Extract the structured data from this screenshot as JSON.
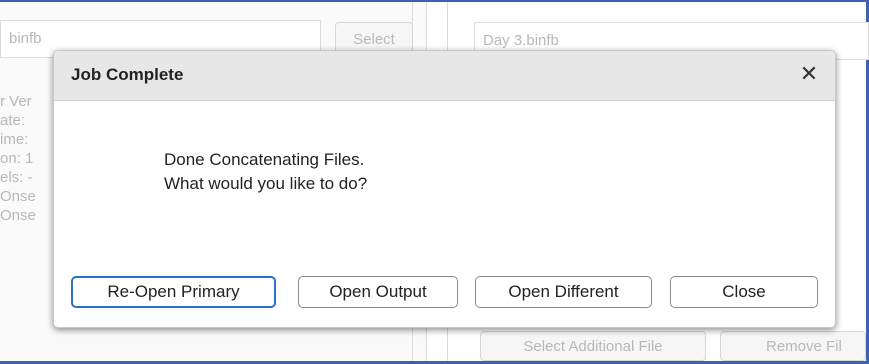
{
  "background": {
    "primary_file": {
      "value": "binfb"
    },
    "select_button": {
      "label": "Select"
    },
    "secondary_file": {
      "value": "Day 3.binfb"
    },
    "info_lines": [
      "r Ver",
      "ate:",
      "ime:",
      "on: 1",
      "els: -",
      "Onse",
      "Onse"
    ],
    "select_additional_button": {
      "label": "Select Additional File"
    },
    "remove_file_button": {
      "label": "Remove Fil"
    }
  },
  "dialog": {
    "title": "Job Complete",
    "close_glyph": "✕",
    "message_lines": [
      "Done Concatenating Files.",
      "What would you like to do?"
    ],
    "buttons": [
      {
        "label": "Re-Open Primary",
        "focused": true
      },
      {
        "label": "Open Output",
        "focused": false
      },
      {
        "label": "Open Different",
        "focused": false
      },
      {
        "label": "Close",
        "focused": false
      }
    ]
  },
  "colors": {
    "frame_border": "#3a64b0",
    "focus_ring": "#2f6fc9",
    "dialog_header": "#e7e7e7"
  }
}
